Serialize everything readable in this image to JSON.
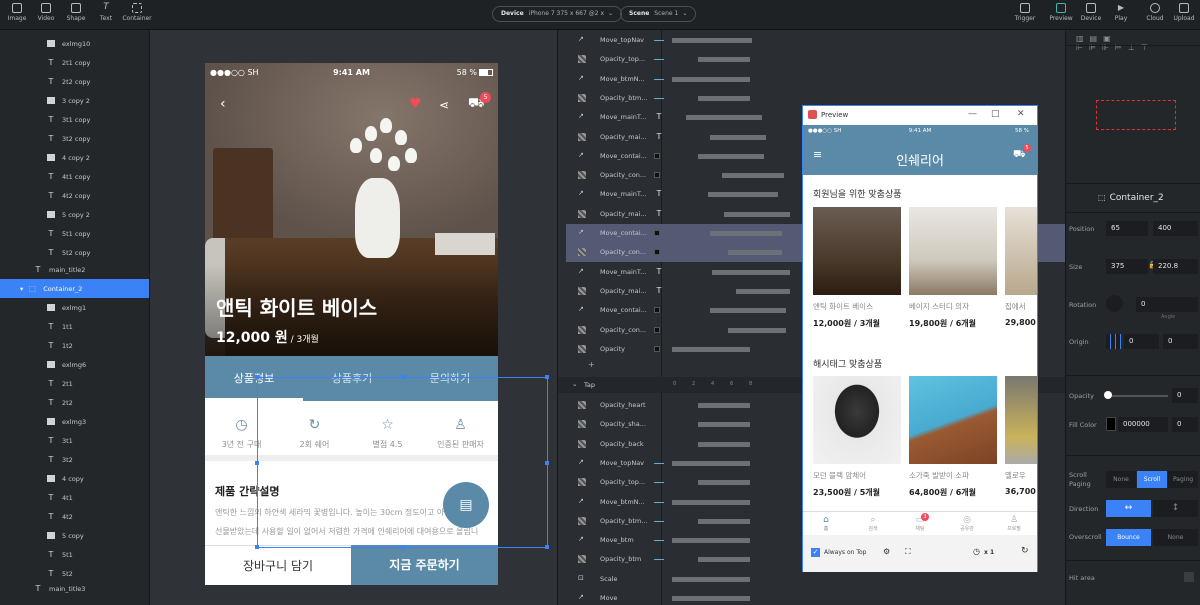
{
  "toolbar": {
    "left_tools": [
      "Image",
      "Video",
      "Shape",
      "Text",
      "Container"
    ],
    "device_label": "Device",
    "device_value": "iPhone 7  375 x 667  @2 x",
    "scene_label": "Scene",
    "scene_value": "Scene 1",
    "right_tools": [
      "Trigger",
      "Preview",
      "Device",
      "Play",
      "Cloud",
      "Upload"
    ]
  },
  "layers": [
    {
      "type": "image",
      "name": "exlmg10"
    },
    {
      "type": "text",
      "name": "2t1 copy"
    },
    {
      "type": "text",
      "name": "2t2 copy"
    },
    {
      "type": "image",
      "name": "3 copy 2"
    },
    {
      "type": "text",
      "name": "3t1 copy"
    },
    {
      "type": "text",
      "name": "3t2 copy"
    },
    {
      "type": "image",
      "name": "4 copy 2"
    },
    {
      "type": "text",
      "name": "4t1 copy"
    },
    {
      "type": "text",
      "name": "4t2 copy"
    },
    {
      "type": "image",
      "name": "5 copy 2"
    },
    {
      "type": "text",
      "name": "5t1 copy"
    },
    {
      "type": "text",
      "name": "5t2 copy"
    },
    {
      "type": "text",
      "name": "main_title2"
    },
    {
      "type": "container",
      "name": "Container_2",
      "selected": true
    },
    {
      "type": "image",
      "name": "exlmg1"
    },
    {
      "type": "text",
      "name": "1t1"
    },
    {
      "type": "text",
      "name": "1t2"
    },
    {
      "type": "image",
      "name": "exlmg6"
    },
    {
      "type": "text",
      "name": "2t1"
    },
    {
      "type": "text",
      "name": "2t2"
    },
    {
      "type": "image",
      "name": "exlmg3"
    },
    {
      "type": "text",
      "name": "3t1"
    },
    {
      "type": "text",
      "name": "3t2"
    },
    {
      "type": "image",
      "name": "4 copy"
    },
    {
      "type": "text",
      "name": "4t1"
    },
    {
      "type": "text",
      "name": "4t2"
    },
    {
      "type": "image",
      "name": "5 copy"
    },
    {
      "type": "text",
      "name": "5t1"
    },
    {
      "type": "text",
      "name": "5t2"
    },
    {
      "type": "text",
      "name": "main_title3"
    }
  ],
  "phone": {
    "status_carrier": "●●●○○ SH",
    "status_time": "9:41 AM",
    "status_battery": "58 %",
    "cart_badge": "5",
    "title": "앤틱 화이트 베이스",
    "price": "12,000 원",
    "price_period": " / 3개월",
    "tabs": [
      "상품정보",
      "상품후기",
      "문의하기"
    ],
    "features": [
      {
        "icon": "clock-icon",
        "glyph": "◷",
        "label": "3년 전 구매"
      },
      {
        "icon": "refresh-icon",
        "glyph": "↻",
        "label": "2회 쉐어"
      },
      {
        "icon": "star-icon",
        "glyph": "☆",
        "label": "별점 4.5"
      },
      {
        "icon": "user-icon",
        "glyph": "♙",
        "label": "인증된 판매자"
      }
    ],
    "desc_title": "제품 간략설명",
    "desc_text": "앤틱한 느낌의 하얀색 세라믹 꽃병입니다. 높이는 30cm 정도이고 아는 지인에게 선물받았는데 사용할 일이 없어서 저렴한 가격에 인쉐리어에 대여용으로 올립니다. 많은 문의 부탁드려요~",
    "btn_cart": "장바구니 담기",
    "btn_order": "지금 주문하기"
  },
  "timeline": {
    "rows_top": [
      {
        "icon": "move",
        "name": "Move_topNav",
        "tag": "dash"
      },
      {
        "icon": "opacity",
        "name": "Opacity_top...",
        "tag": "dash"
      },
      {
        "icon": "move",
        "name": "Move_btmN...",
        "tag": "dash"
      },
      {
        "icon": "opacity",
        "name": "Opacity_btm...",
        "tag": "dash"
      },
      {
        "icon": "move",
        "name": "Move_mainT...",
        "tag": "T"
      },
      {
        "icon": "opacity",
        "name": "Opacity_mai...",
        "tag": "T"
      },
      {
        "icon": "move",
        "name": "Move_contai...",
        "tag": "blk"
      },
      {
        "icon": "opacity",
        "name": "Opacity_con...",
        "tag": "blk"
      },
      {
        "icon": "move",
        "name": "Move_mainT...",
        "tag": "T"
      },
      {
        "icon": "opacity",
        "name": "Opacity_mai...",
        "tag": "T"
      },
      {
        "icon": "move",
        "name": "Move_contai...",
        "tag": "blk",
        "selected": true
      },
      {
        "icon": "opacity",
        "name": "Opacity_con...",
        "tag": "blk",
        "selected": true
      },
      {
        "icon": "move",
        "name": "Move_mainT...",
        "tag": "T"
      },
      {
        "icon": "opacity",
        "name": "Opacity_mai...",
        "tag": "T"
      },
      {
        "icon": "move",
        "name": "Move_contai...",
        "tag": "blk"
      },
      {
        "icon": "opacity",
        "name": "Opacity_con...",
        "tag": "blk"
      },
      {
        "icon": "opacity",
        "name": "Opacity",
        "tag": "blk"
      }
    ],
    "tap_label": "Tap",
    "ruler": [
      "0",
      "2",
      "4",
      "6",
      "8"
    ],
    "rows_bottom": [
      {
        "icon": "opacity",
        "name": "Opacity_heart",
        "tag": ""
      },
      {
        "icon": "opacity",
        "name": "Opacity_sha...",
        "tag": ""
      },
      {
        "icon": "opacity",
        "name": "Opacity_back",
        "tag": ""
      },
      {
        "icon": "move",
        "name": "Move_topNav",
        "tag": "dash"
      },
      {
        "icon": "opacity",
        "name": "Opacity_top...",
        "tag": "dash"
      },
      {
        "icon": "move",
        "name": "Move_btmN...",
        "tag": "dash"
      },
      {
        "icon": "opacity",
        "name": "Opacity_btm...",
        "tag": "dash"
      },
      {
        "icon": "move",
        "name": "Move_btm",
        "tag": "dash"
      },
      {
        "icon": "opacity",
        "name": "Opacity_btm",
        "tag": "dash"
      },
      {
        "icon": "scale",
        "name": "Scale",
        "tag": ""
      },
      {
        "icon": "move",
        "name": "Move",
        "tag": ""
      }
    ]
  },
  "preview": {
    "window_title": "Preview",
    "status_carrier": "●●●○○ SH",
    "status_time": "9:41 AM",
    "status_battery": "58 %",
    "logo": "인쉐리어",
    "cart_badge": "5",
    "section1": "회원님을 위한 맞춤상품",
    "section2": "해시태그 맞춤상품",
    "cards1": [
      {
        "name": "앤틱 화이트 베이스",
        "price": "12,000원 / 3개월"
      },
      {
        "name": "베이지 스터디 의자",
        "price": "19,800원 / 6개월"
      },
      {
        "name": "집에서",
        "price": "29,800"
      }
    ],
    "cards2": [
      {
        "name": "모던 블랙 암체어",
        "price": "23,500원 / 5개월"
      },
      {
        "name": "소가죽 발받이 소파",
        "price": "64,800원 / 6개월"
      },
      {
        "name": "옐로우",
        "price": "36,700"
      }
    ],
    "tabbar": [
      {
        "icon": "home-icon",
        "glyph": "⌂",
        "label": "홈"
      },
      {
        "icon": "search-icon",
        "glyph": "⌕",
        "label": "검색"
      },
      {
        "icon": "chat-icon",
        "glyph": "▭",
        "label": "채팅",
        "badge": "3"
      },
      {
        "icon": "bulb-icon",
        "glyph": "◎",
        "label": "공유관"
      },
      {
        "icon": "profile-icon",
        "glyph": "♙",
        "label": "프로필"
      }
    ],
    "always_on_top": "Always on Top",
    "speed": "x 1"
  },
  "props": {
    "position_label": "Position",
    "position_x": "65",
    "position_y": "400",
    "size_label": "Size",
    "size_w": "375",
    "size_h": "220.8",
    "rotation_label": "Rotation",
    "rotation": "0",
    "angle_label": "Angle",
    "origin_label": "Origin",
    "origin_x": "0",
    "origin_y": "0",
    "element_name": "Container_2",
    "opacity_label": "Opacity",
    "opacity": "0",
    "fill_label": "Fill Color",
    "fill_hex": "000000",
    "fill_alpha": "0",
    "scroll_label": "Scroll Paging",
    "scroll_options": [
      "None",
      "Scroll",
      "Paging"
    ],
    "direction_label": "Direction",
    "overscroll_label": "Overscroll",
    "overscroll_options": [
      "Bounce",
      "None"
    ],
    "hit_area_label": "Hit area"
  }
}
